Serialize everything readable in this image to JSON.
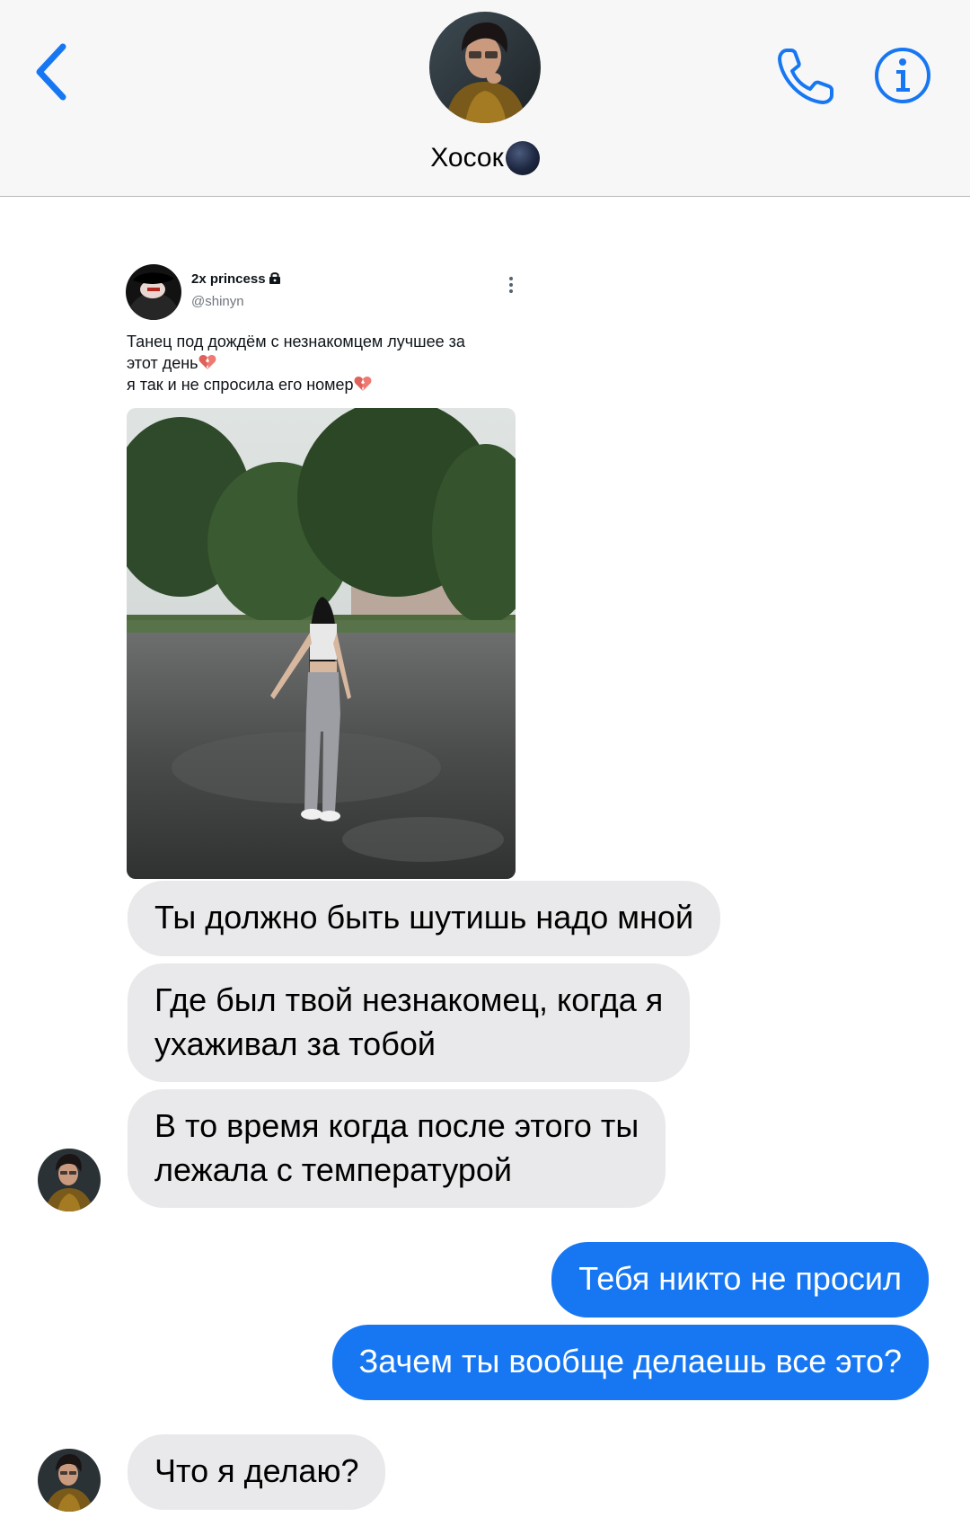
{
  "header": {
    "contact_name": "Хосок",
    "back_icon": "chevron-left-icon",
    "call_icon": "phone-icon",
    "info_icon": "info-icon",
    "accent_color": "#1777f2"
  },
  "shared_post": {
    "author_name": "2x princess",
    "author_handle": "@shinyn",
    "locked_icon": "lock-icon",
    "text_lines": [
      "Танец под дождём с незнакомцем лучшее за",
      "этот день",
      "я так и не спросила его номер"
    ],
    "emoji": "broken-heart-icon"
  },
  "messages": [
    {
      "from": "contact",
      "text": [
        "Ты должно быть шутишь надо мной"
      ]
    },
    {
      "from": "contact",
      "text": [
        "Где был твой незнакомец, когда я",
        "ухаживал за тобой"
      ]
    },
    {
      "from": "contact",
      "text": [
        "В то время когда после этого ты",
        "лежала с температурой"
      ]
    },
    {
      "from": "me",
      "text": [
        "Тебя никто не просил"
      ]
    },
    {
      "from": "me",
      "text": [
        "Зачем ты вообще делаешь все это?"
      ]
    },
    {
      "from": "contact",
      "text": [
        "Что я делаю?"
      ]
    }
  ],
  "colors": {
    "incoming_bubble": "#e9e9eb",
    "outgoing_bubble": "#1777f2"
  }
}
